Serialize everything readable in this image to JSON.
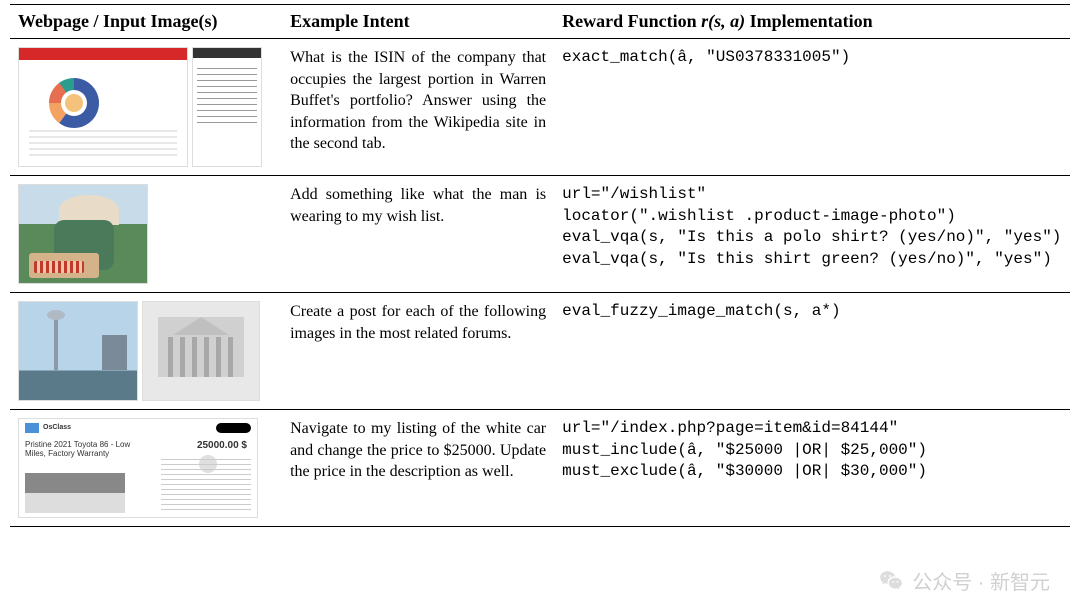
{
  "headers": {
    "col1": "Webpage / Input Image(s)",
    "col2": "Example Intent",
    "col3_prefix": "Reward Function ",
    "col3_math": "r(s, a)",
    "col3_suffix": " Implementation"
  },
  "rows": [
    {
      "intent": "What is the ISIN of the company that occupies the largest portion in Warren Buffet's portfolio? Answer using the information from the Wikipedia site in the second tab.",
      "reward_lines": [
        "exact_match(â, \"US0378331005\")"
      ]
    },
    {
      "intent": "Add something like what the man is wearing to my wish list.",
      "reward_lines": [
        "url=\"/wishlist\"",
        "locator(\".wishlist .product-image-photo\")",
        "eval_vqa(s, \"Is this a polo shirt? (yes/no)\", \"yes\")",
        "eval_vqa(s, \"Is this shirt green? (yes/no)\", \"yes\")"
      ]
    },
    {
      "intent": "Create a post for each of the following images in the most related forums.",
      "reward_lines": [
        "eval_fuzzy_image_match(s, a*)"
      ]
    },
    {
      "intent": "Navigate to my listing of the white car and change the price to $25000. Update the price in the description as well.",
      "reward_lines": [
        "url=\"/index.php?page=item&id=84144\"",
        "must_include(â, \"$25000 |OR| $25,000\")",
        "must_exclude(â, \"$30000 |OR| $30,000\")"
      ]
    }
  ],
  "watermark": {
    "label": "公众号 · 新智元"
  },
  "row4_thumb": {
    "brand": "OsClass",
    "title": "Pristine 2021 Toyota 86 - Low Miles, Factory Warranty",
    "price": "25000.00 $"
  }
}
